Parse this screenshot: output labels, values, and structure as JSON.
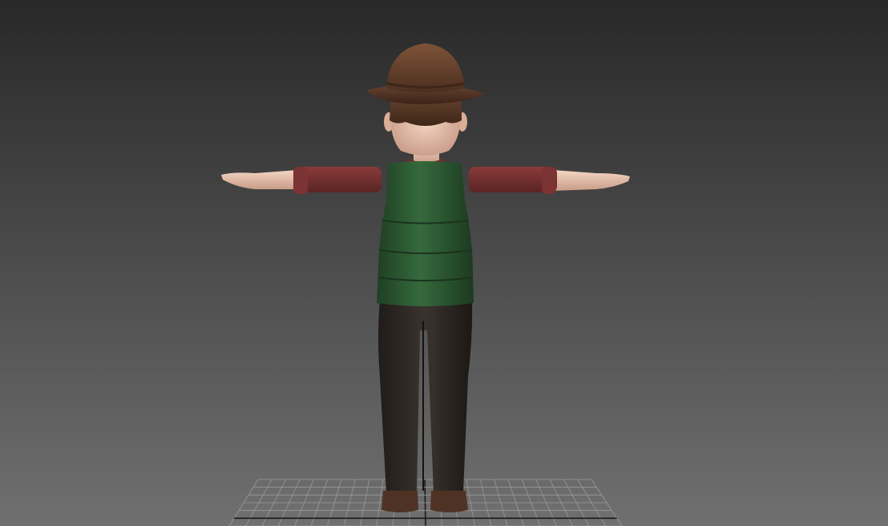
{
  "viewport": {
    "background_top": "#282828",
    "background_bottom": "#707070",
    "grid_color": "#9a9a9a",
    "grid_axis_color": "#1a1a1a"
  },
  "character": {
    "pose": "t-pose",
    "view": "back",
    "hat_color": "#6b4530",
    "hair_color": "#5a3a26",
    "skin_color": "#e9c2ae",
    "shirt_color": "#7a3232",
    "vest_color": "#2f5a35",
    "pants_color": "#36302b",
    "shoes_color": "#4e3324"
  }
}
